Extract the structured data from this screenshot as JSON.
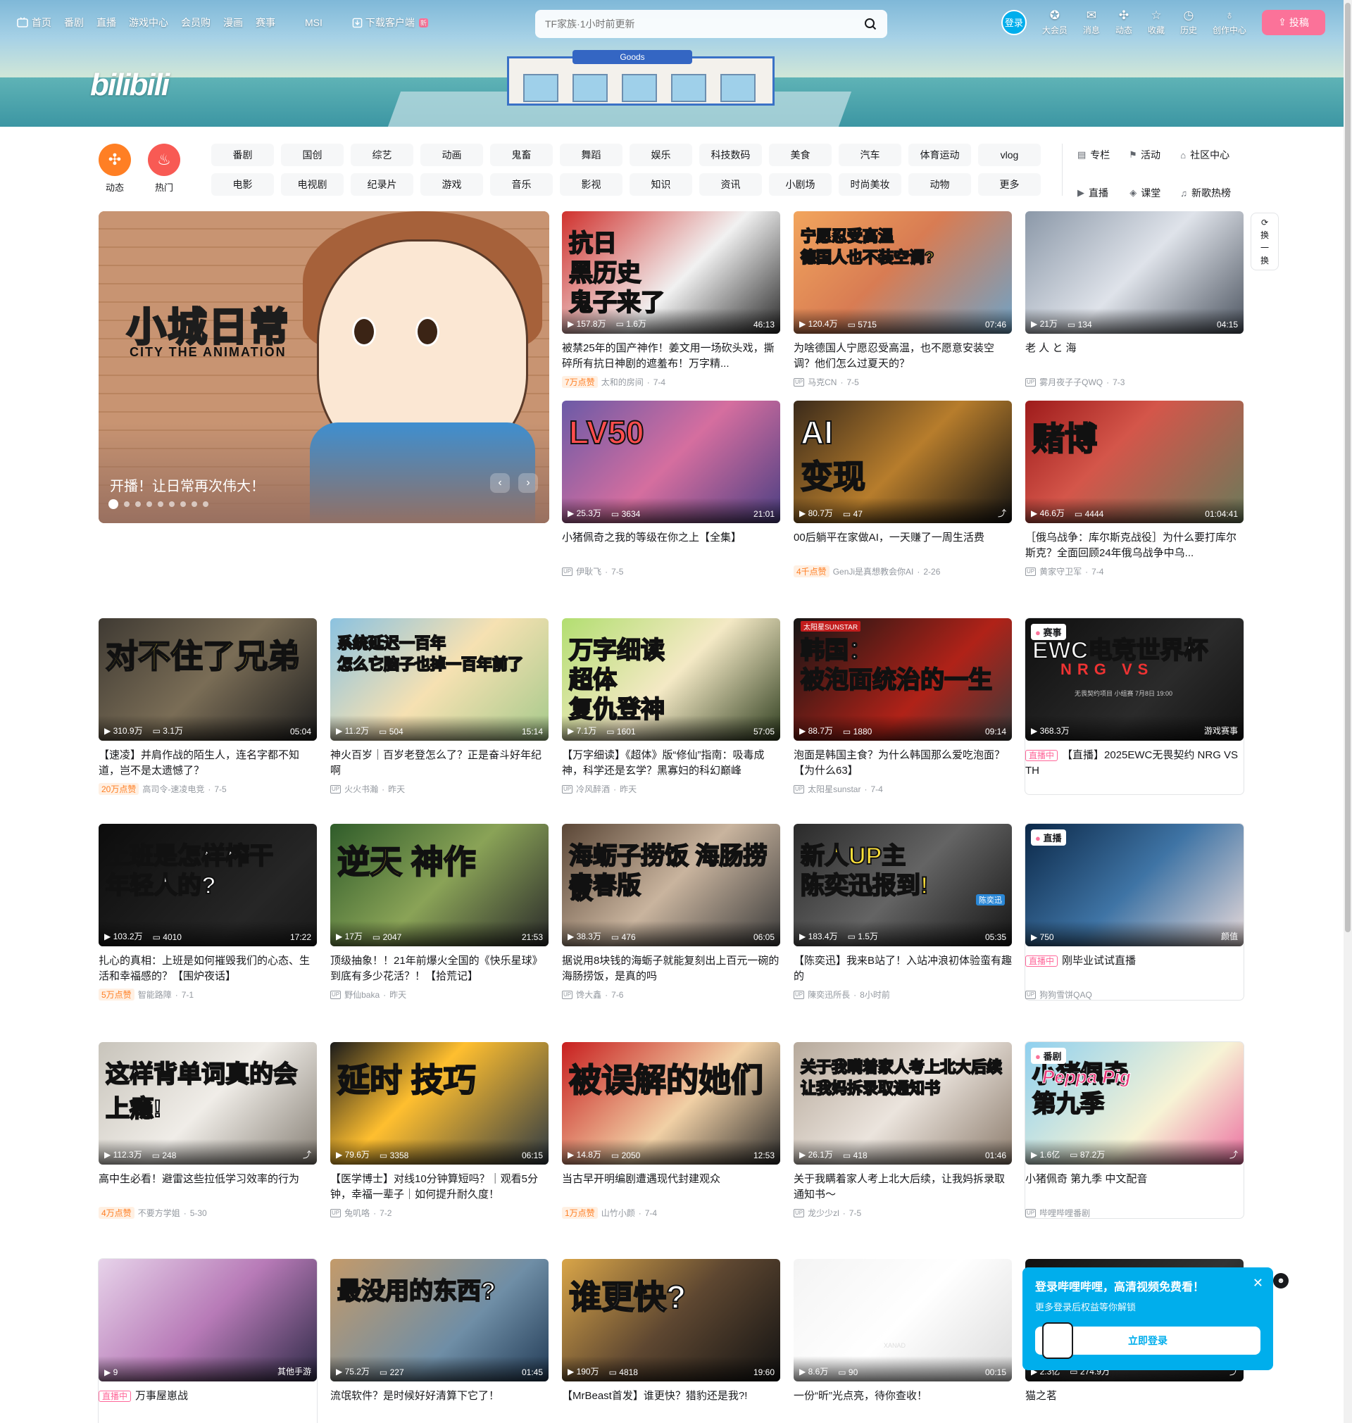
{
  "nav": {
    "items": [
      "首页",
      "番剧",
      "直播",
      "游戏中心",
      "会员购",
      "漫画",
      "赛事",
      "MSI"
    ],
    "download": "下载客户端",
    "download_badge": "新",
    "search_placeholder": "TF家族·1小时前更新",
    "login": "登录",
    "right_items": [
      "大会员",
      "消息",
      "动态",
      "收藏",
      "历史",
      "创作中心"
    ],
    "upload": "投稿",
    "logo": "bilibili"
  },
  "channels": {
    "circles": [
      {
        "label": "动态",
        "color": "#ff7f24"
      },
      {
        "label": "热门",
        "color": "#f85a54"
      }
    ],
    "tags": [
      "番剧",
      "国创",
      "综艺",
      "动画",
      "鬼畜",
      "舞蹈",
      "娱乐",
      "科技数码",
      "美食",
      "汽车",
      "体育运动",
      "vlog",
      "电影",
      "电视剧",
      "纪录片",
      "游戏",
      "音乐",
      "影视",
      "知识",
      "资讯",
      "小剧场",
      "时尚美妆",
      "动物",
      "更多"
    ],
    "side": [
      "专栏",
      "活动",
      "社区中心",
      "直播",
      "课堂",
      "新歌热榜"
    ]
  },
  "carousel": {
    "caption": "开播！让日常再次伟大！",
    "art_title_a": "小城",
    "art_title_b": "日常",
    "art_sub": "CITY THE ANIMATION"
  },
  "refresh": {
    "label_a": "换",
    "label_b": "一",
    "label_c": "换"
  },
  "cards": [
    {
      "title": "被禁25年的国产神作！姜文用一场砍头戏，撕碎所有抗日神剧的遮羞布！万字精...",
      "views": "157.8万",
      "danmaku": "1.6万",
      "duration": "46:13",
      "likes": "7万点赞",
      "author": "太和的房间",
      "date": "7-4",
      "art": "抗日\n黑历史\n鬼子来了"
    },
    {
      "title": "为啥德国人宁愿忍受高温，也不愿意安装空调？他们怎么过夏天的？",
      "views": "120.4万",
      "danmaku": "5715",
      "duration": "07:46",
      "author": "马克CN",
      "date": "7-5",
      "art": "宁愿忍受高温\n德国人也不装空调?"
    },
    {
      "title": "老 人 と 海",
      "views": "21万",
      "danmaku": "134",
      "duration": "04:15",
      "author": "雾月夜子子QWQ",
      "date": "7-3",
      "art": ""
    },
    {
      "title": "小猪佩奇之我的等级在你之上【全集】",
      "views": "25.3万",
      "danmaku": "3634",
      "duration": "21:01",
      "author": "伊耿飞",
      "date": "7-5",
      "art": "LV50"
    },
    {
      "title": "00后躺平在家做AI，一天赚了一周生活费",
      "views": "80.7万",
      "danmaku": "47",
      "duration": "",
      "likes": "4千点赞",
      "author": "GenJi是真想教会你AI",
      "date": "2-26",
      "art": "AI\n变现"
    },
    {
      "title": "［俄乌战争：库尔斯克战役］为什么要打库尔斯克？全面回顾24年俄乌战争中乌...",
      "views": "46.6万",
      "danmaku": "4444",
      "duration": "01:04:41",
      "author": "黄家守卫军",
      "date": "7-4",
      "art": "赌博"
    },
    {
      "title": "【速凌】并肩作战的陌生人，连名字都不知道，岂不是太遗憾了？",
      "views": "310.9万",
      "danmaku": "3.1万",
      "duration": "05:04",
      "likes": "20万点赞",
      "author": "高司令-速凌电竞",
      "date": "7-5",
      "art": "对不住了兄弟"
    },
    {
      "title": "神火百岁｜百岁老登怎么了？正是奋斗好年纪啊",
      "views": "11.2万",
      "danmaku": "504",
      "duration": "15:14",
      "author": "火火书瀚",
      "date": "昨天",
      "art": "系统延迟一百年\n怎么它脑子也掉一百年前了"
    },
    {
      "title": "【万字细读】《超体》版“修仙”指南：吸毒成神，科学还是玄学？黑寡妇的科幻巅峰",
      "views": "7.1万",
      "danmaku": "1601",
      "duration": "57:05",
      "author": "冷风醉酒",
      "date": "昨天",
      "art": "万字细读\n超体\n复仇登神"
    },
    {
      "title": "泡面是韩国主食？为什么韩国那么爱吃泡面？【为什么63】",
      "views": "88.7万",
      "danmaku": "1880",
      "duration": "09:14",
      "author": "太阳星sunstar",
      "date": "7-4",
      "art": "韩国：\n被泡面统治的一生",
      "art_brand": "太阳星SUNSTAR"
    },
    {
      "title": "【直播】2025EWC无畏契约 NRG VS TH",
      "views": "368.3万",
      "corner": "赛事",
      "duration": "游戏赛事",
      "live": "直播中",
      "art": "EWC电竞世界杯",
      "art_teams": "NRG VS",
      "art_sub": "无畏契约项目 小组赛  7月8日 19:00"
    },
    {
      "title": "扎心的真相：上班是如何摧毁我们的心态、生活和幸福感的？【围炉夜话】",
      "views": "103.2万",
      "danmaku": "4010",
      "duration": "17:22",
      "likes": "5万点赞",
      "author": "智能路障",
      "date": "7-1",
      "art": "上班是怎样榨干\n年轻人的?"
    },
    {
      "title": "顶级抽象！！21年前爆火全国的《快乐星球》到底有多少花活？！【拾荒记】",
      "views": "17万",
      "danmaku": "2047",
      "duration": "21:53",
      "author": "野仙baka",
      "date": "昨天",
      "art": "逆天 神作"
    },
    {
      "title": "据说用8块钱的海蛎子就能复刻出上百元一碗的海肠捞饭，是真的吗",
      "views": "38.3万",
      "danmaku": "476",
      "duration": "06:05",
      "author": "馋大鑫",
      "date": "7-6",
      "art": "海蛎子捞饭 海肠捞饭\n青春版"
    },
    {
      "title": "【陈奕迅】我来B站了！入站冲浪初体验蛮有趣的",
      "views": "183.4万",
      "danmaku": "1.5万",
      "duration": "05:35",
      "author": "陳奕迅所長",
      "date": "8小时前",
      "art": "新人UP主\n陈奕迅报到!",
      "art_tag": "陈奕迅"
    },
    {
      "title": "刚毕业试试直播",
      "views": "750",
      "corner": "直播",
      "duration": "颜值",
      "live": "直播中",
      "author": "狗狗雪饼QAQ",
      "art": ""
    },
    {
      "title": "高中生必看！避雷这些拉低学习效率的行为",
      "views": "112.3万",
      "danmaku": "248",
      "duration": "",
      "likes": "4万点赞",
      "author": "不要方学姐",
      "date": "5-30",
      "art": "这样背单词真的会上瘾!"
    },
    {
      "title": "【医学博士】对线10分钟算短吗？｜观看5分钟，幸福一辈子｜如何提升耐久度！",
      "views": "79.6万",
      "danmaku": "3358",
      "duration": "06:15",
      "author": "兔叽咯",
      "date": "7-2",
      "art": "延时 技巧"
    },
    {
      "title": "当古早开明编剧遭遇现代封建观众",
      "views": "14.8万",
      "danmaku": "2050",
      "duration": "12:53",
      "likes": "1万点赞",
      "author": "山竹小颜",
      "date": "7-4",
      "art": "被误解的她们"
    },
    {
      "title": "关于我瞒着家人考上北大后续，让我妈拆录取通知书～",
      "views": "26.1万",
      "danmaku": "418",
      "duration": "01:46",
      "author": "龙少少zl",
      "date": "7-5",
      "art": "关于我瞒着家人考上北大后续\n让我妈拆录取通知书"
    },
    {
      "title": "小猪佩奇 第九季 中文配音",
      "views": "1.6亿",
      "danmaku": "87.2万",
      "corner": "番剧",
      "duration": "",
      "author": "哔哩哔哩番剧",
      "art": "小猪佩奇\n第九季",
      "art_logo": "Peppa Pig"
    },
    {
      "title": "万事屋崽战",
      "views": "9",
      "duration": "其他手游",
      "live": "直播中",
      "art": ""
    },
    {
      "title": "流氓软件？是时候好好清算下它了！",
      "views": "75.2万",
      "danmaku": "227",
      "duration": "01:45",
      "art": "最没用的东西?"
    },
    {
      "title": "【MrBeast首发】谁更快？猎豹还是我?!",
      "views": "190万",
      "danmaku": "4818",
      "duration": "19:60",
      "art": "谁更快?"
    },
    {
      "title": "一份“昕”光点亮，待你查收！",
      "views": "8.6万",
      "danmaku": "90",
      "duration": "00:15",
      "art": "",
      "art_shirt": "XANAD"
    },
    {
      "title": "猫之茗",
      "views": "2.3亿",
      "danmaku": "274.9万",
      "art": ""
    }
  ],
  "popup": {
    "title": "登录哔哩哔哩，高清视频免费看！",
    "subtitle": "更多登录后权益等你解锁",
    "button": "立即登录"
  }
}
